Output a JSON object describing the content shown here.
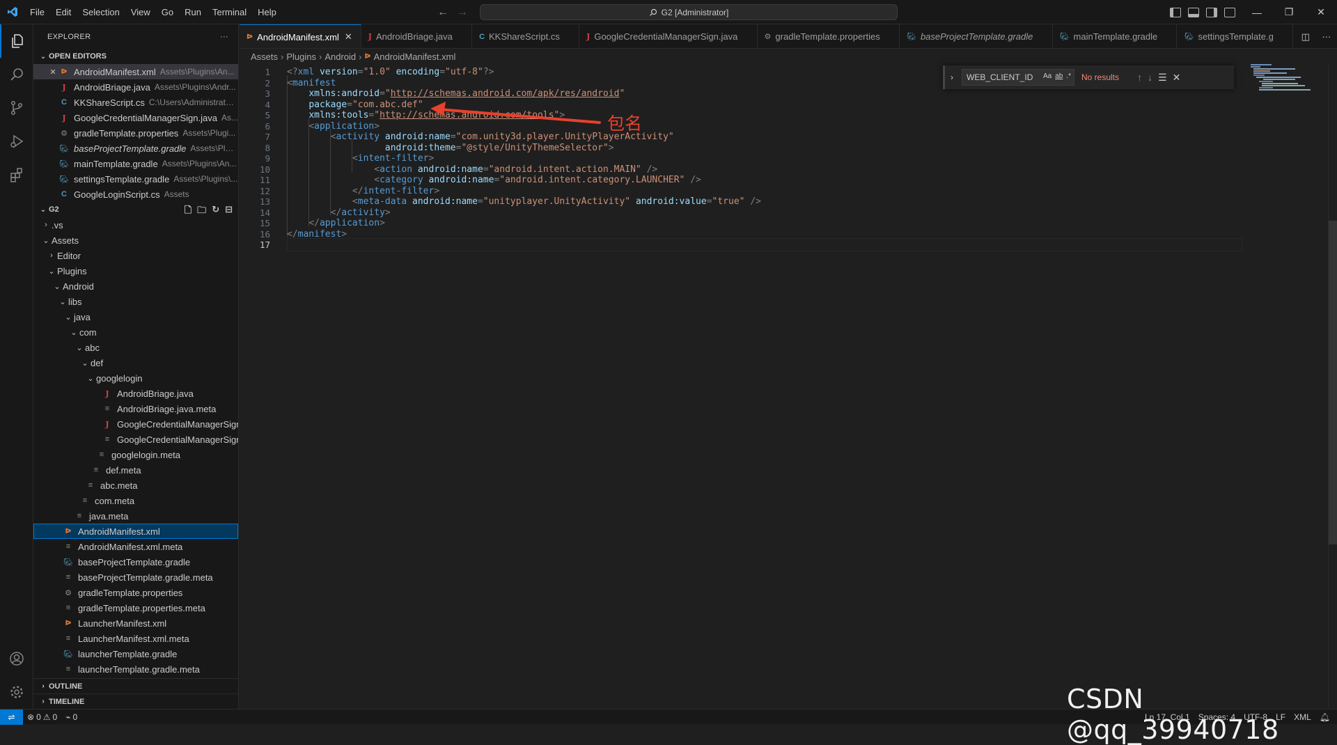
{
  "titlebar": {
    "menu": [
      "File",
      "Edit",
      "Selection",
      "View",
      "Go",
      "Run",
      "Terminal",
      "Help"
    ],
    "search_text": "G2 [Administrator]"
  },
  "sidebar": {
    "title": "EXPLORER",
    "more": "···",
    "open_editors_title": "OPEN EDITORS",
    "open_editors": [
      {
        "name": "AndroidManifest.xml",
        "desc": "Assets\\Plugins\\An...",
        "icon": "xml-icon"
      },
      {
        "name": "AndroidBriage.java",
        "desc": "Assets\\Plugins\\Andr...",
        "icon": "java-icon"
      },
      {
        "name": "KKShareScript.cs",
        "desc": "C:\\Users\\Administrator...",
        "icon": "csharp-icon"
      },
      {
        "name": "GoogleCredentialManagerSign.java",
        "desc": "As...",
        "icon": "java-icon"
      },
      {
        "name": "gradleTemplate.properties",
        "desc": "Assets\\Plugi...",
        "icon": "gear-icon"
      },
      {
        "name": "baseProjectTemplate.gradle",
        "desc": "Assets\\Plugi...",
        "icon": "gradle-icon"
      },
      {
        "name": "mainTemplate.gradle",
        "desc": "Assets\\Plugins\\An...",
        "icon": "gradle-icon"
      },
      {
        "name": "settingsTemplate.gradle",
        "desc": "Assets\\Plugins\\...",
        "icon": "gradle-icon"
      },
      {
        "name": "GoogleLoginScript.cs",
        "desc": "Assets",
        "icon": "csharp-icon"
      }
    ],
    "folder_title": "G2",
    "tree": [
      {
        "name": ".vs",
        "type": "folder-closed"
      },
      {
        "name": "Assets",
        "type": "folder-open"
      },
      {
        "name": "Editor",
        "type": "folder-closed"
      },
      {
        "name": "Plugins",
        "type": "folder-open"
      },
      {
        "name": "Android",
        "type": "folder-open"
      },
      {
        "name": "libs",
        "type": "folder-open"
      },
      {
        "name": "java",
        "type": "folder-open"
      },
      {
        "name": "com",
        "type": "folder-open"
      },
      {
        "name": "abc",
        "type": "folder-open"
      },
      {
        "name": "def",
        "type": "folder-open"
      },
      {
        "name": "googlelogin",
        "type": "folder-open"
      },
      {
        "name": "AndroidBriage.java",
        "type": "java"
      },
      {
        "name": "AndroidBriage.java.meta",
        "type": "meta"
      },
      {
        "name": "GoogleCredentialManagerSign....",
        "type": "java"
      },
      {
        "name": "GoogleCredentialManagerSign....",
        "type": "meta"
      },
      {
        "name": "googlelogin.meta",
        "type": "meta"
      },
      {
        "name": "def.meta",
        "type": "meta"
      },
      {
        "name": "abc.meta",
        "type": "meta"
      },
      {
        "name": "com.meta",
        "type": "meta"
      },
      {
        "name": "java.meta",
        "type": "meta"
      },
      {
        "name": "AndroidManifest.xml",
        "type": "xml"
      },
      {
        "name": "AndroidManifest.xml.meta",
        "type": "meta"
      },
      {
        "name": "baseProjectTemplate.gradle",
        "type": "gradle"
      },
      {
        "name": "baseProjectTemplate.gradle.meta",
        "type": "meta"
      },
      {
        "name": "gradleTemplate.properties",
        "type": "gear"
      },
      {
        "name": "gradleTemplate.properties.meta",
        "type": "meta"
      },
      {
        "name": "LauncherManifest.xml",
        "type": "xml"
      },
      {
        "name": "LauncherManifest.xml.meta",
        "type": "meta"
      },
      {
        "name": "launcherTemplate.gradle",
        "type": "gradle"
      },
      {
        "name": "launcherTemplate.gradle.meta",
        "type": "meta"
      }
    ],
    "outline_title": "OUTLINE",
    "timeline_title": "TIMELINE"
  },
  "tabs": [
    {
      "label": "AndroidManifest.xml",
      "icon": "xml-icon",
      "active": true
    },
    {
      "label": "AndroidBriage.java",
      "icon": "java-icon"
    },
    {
      "label": "KKShareScript.cs",
      "icon": "csharp-icon"
    },
    {
      "label": "GoogleCredentialManagerSign.java",
      "icon": "java-icon"
    },
    {
      "label": "gradleTemplate.properties",
      "icon": "gear-icon"
    },
    {
      "label": "baseProjectTemplate.gradle",
      "icon": "gradle-icon",
      "italic": true
    },
    {
      "label": "mainTemplate.gradle",
      "icon": "gradle-icon"
    },
    {
      "label": "settingsTemplate.g",
      "icon": "gradle-icon"
    }
  ],
  "breadcrumb": [
    "Assets",
    "Plugins",
    "Android",
    "AndroidManifest.xml"
  ],
  "editor": {
    "line_numbers": [
      "1",
      "2",
      "3",
      "4",
      "5",
      "6",
      "7",
      "8",
      "9",
      "10",
      "11",
      "12",
      "13",
      "14",
      "15",
      "16",
      "17"
    ],
    "current_line": "17",
    "lines": [
      "<?xml version=\"1.0\" encoding=\"utf-8\"?>",
      "<manifest",
      "    xmlns:android=\"http://schemas.android.com/apk/res/android\"",
      "    package=\"com.abc.def\"",
      "    xmlns:tools=\"http://schemas.android.com/tools\">",
      "    <application>",
      "        <activity android:name=\"com.unity3d.player.UnityPlayerActivity\"",
      "                  android:theme=\"@style/UnityThemeSelector\">",
      "            <intent-filter>",
      "                <action android:name=\"android.intent.action.MAIN\" />",
      "                <category android:name=\"android.intent.category.LAUNCHER\" />",
      "            </intent-filter>",
      "            <meta-data android:name=\"unityplayer.UnityActivity\" android:value=\"true\" />",
      "        </activity>",
      "    </application>",
      "</manifest>",
      ""
    ]
  },
  "find": {
    "query": "WEB_CLIENT_ID",
    "opt_case": "Aa",
    "opt_word": "ab",
    "opt_regex": ".*",
    "result": "No results"
  },
  "annotation": {
    "label": "包名",
    "color": "#e8412d"
  },
  "statusbar": {
    "errors": "0",
    "warnings": "0",
    "ports": "0",
    "position": "Ln 17, Col 1",
    "spaces": "Spaces: 4",
    "encoding": "UTF-8",
    "eol": "LF",
    "language": "XML"
  },
  "watermark": "CSDN @qq_39940718",
  "colors": {
    "accent": "#0078d4",
    "background": "#1f1f1f",
    "sidebar_bg": "#181818"
  }
}
